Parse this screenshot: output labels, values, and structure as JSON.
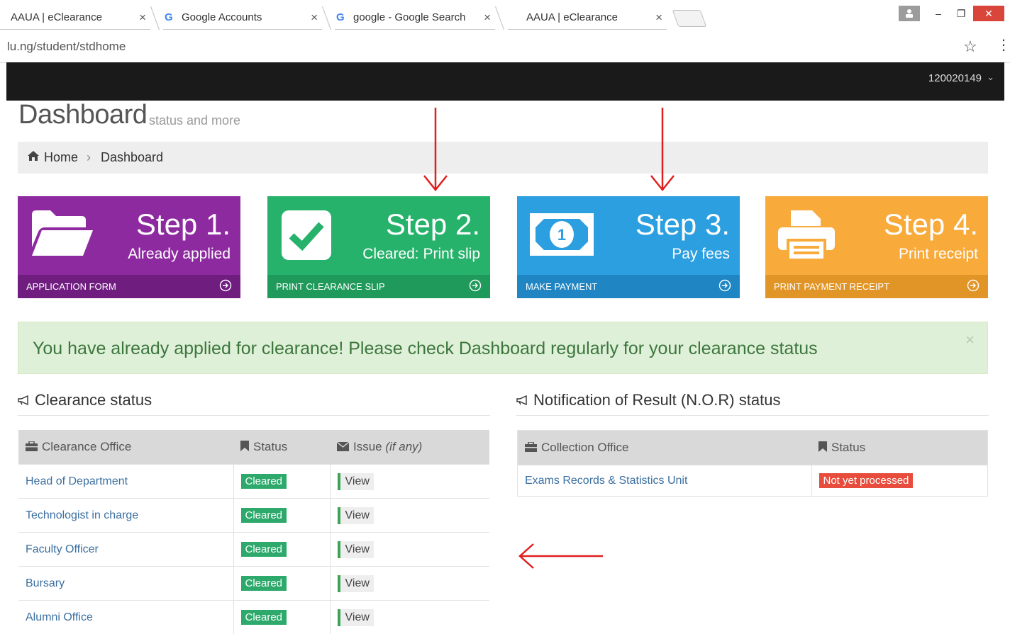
{
  "browser": {
    "tabs": [
      {
        "title": "AAUA | eClearance",
        "has_google_icon": false
      },
      {
        "title": "Google Accounts",
        "has_google_icon": true
      },
      {
        "title": "google - Google Search",
        "has_google_icon": true
      },
      {
        "title": "AAUA | eClearance",
        "has_google_icon": false
      }
    ],
    "tab_close_glyph": "×",
    "google_glyph": "G",
    "url": "lu.ng/student/stdhome",
    "window_controls": {
      "minimize": "–",
      "restore": "❐",
      "close": "✕"
    }
  },
  "navbar": {
    "username": "120020149"
  },
  "header": {
    "title": "Dashboard",
    "subtitle": "status and more"
  },
  "breadcrumb": {
    "home": "Home",
    "current": "Dashboard"
  },
  "steps": [
    {
      "step": "Step 1.",
      "sub": "Already applied",
      "footer": "APPLICATION FORM",
      "color": "#8e2aa0",
      "foot_color": "#6f1e80",
      "icon": "folder-open-icon"
    },
    {
      "step": "Step 2.",
      "sub": "Cleared: Print slip",
      "footer": "PRINT CLEARANCE SLIP",
      "color": "#27b26b",
      "foot_color": "#1f9a5b",
      "icon": "check-square-icon"
    },
    {
      "step": "Step 3.",
      "sub": "Pay fees",
      "footer": "MAKE PAYMENT",
      "color": "#2b9fe0",
      "foot_color": "#1f86c3",
      "icon": "money-bill-icon"
    },
    {
      "step": "Step 4.",
      "sub": "Print receipt",
      "footer": "PRINT PAYMENT RECEIPT",
      "color": "#f8aa3b",
      "foot_color": "#e29527",
      "icon": "printer-icon"
    }
  ],
  "alert": {
    "text": "You have already applied for clearance! Please check Dashboard regularly for your clearance status",
    "close": "×"
  },
  "clearance": {
    "heading": "Clearance status",
    "columns": {
      "office": "Clearance Office",
      "status": "Status",
      "issue": "Issue",
      "issue_note": "(if any)"
    },
    "rows": [
      {
        "office": "Head of Department",
        "status": "Cleared",
        "action": "View"
      },
      {
        "office": "Technologist in charge",
        "status": "Cleared",
        "action": "View"
      },
      {
        "office": "Faculty Officer",
        "status": "Cleared",
        "action": "View"
      },
      {
        "office": "Bursary",
        "status": "Cleared",
        "action": "View"
      },
      {
        "office": "Alumni Office",
        "status": "Cleared",
        "action": "View"
      }
    ]
  },
  "nor": {
    "heading": "Notification of Result (N.O.R) status",
    "columns": {
      "office": "Collection Office",
      "status": "Status"
    },
    "rows": [
      {
        "office": "Exams Records & Statistics Unit",
        "status": "Not yet processed"
      }
    ]
  },
  "colors": {
    "annotation_arrow": "#e02020",
    "link": "#3b6fa0",
    "cleared": "#2ca96b",
    "not_processed": "#e74c3c"
  }
}
